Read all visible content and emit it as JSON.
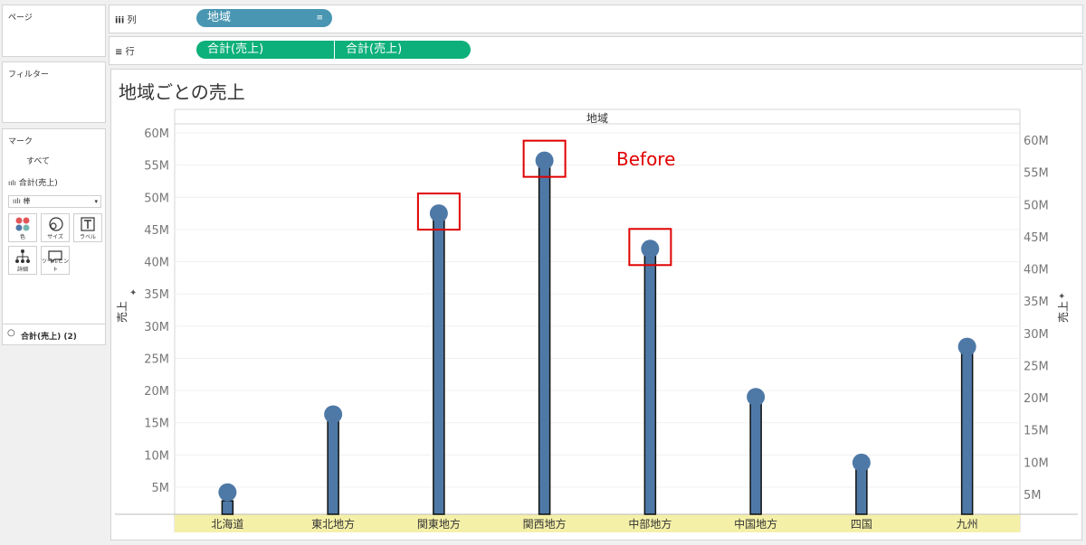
{
  "sidebar": {
    "pages_title": "ページ",
    "filters_title": "フィルター",
    "marks_title": "マーク",
    "marks_all": "すべて",
    "marks_measure": "合計(売上)",
    "mark_type": "棒",
    "mark_buttons": [
      "色",
      "サイズ",
      "ラベル",
      "詳細",
      "ツールヒント"
    ],
    "marks_measure2": "合計(売上) (2)"
  },
  "shelves": {
    "columns_label": "列",
    "rows_label": "行",
    "columns_pill": "地域",
    "rows_pill1": "合計(売上)",
    "rows_pill2": "合計(売上)"
  },
  "view": {
    "title": "地域ごとの売上",
    "header": "地域",
    "annotation": "Before"
  },
  "colors": {
    "bar": "#4e79a7",
    "circle": "#4e79a7",
    "highlight_box": "#e00000",
    "category_band": "#f5f0a8"
  },
  "chart_data": {
    "type": "bar",
    "categories": [
      "北海道",
      "東北地方",
      "関東地方",
      "関西地方",
      "中部地方",
      "中国地方",
      "四国",
      "九州"
    ],
    "values": [
      4.2,
      16.3,
      47.5,
      55.7,
      42.0,
      19.0,
      8.8,
      26.8
    ],
    "y_unit": "M",
    "left_axis": {
      "ylim": [
        0,
        63
      ],
      "ticks": [
        "5M",
        "10M",
        "15M",
        "20M",
        "25M",
        "30M",
        "35M",
        "40M",
        "45M",
        "50M",
        "55M",
        "60M"
      ],
      "label": "売上"
    },
    "right_axis": {
      "ylim": [
        0,
        64
      ],
      "ticks": [
        "5M",
        "10M",
        "15M",
        "20M",
        "25M",
        "30M",
        "35M",
        "40M",
        "45M",
        "50M",
        "55M",
        "60M"
      ],
      "label": "売上"
    },
    "bar_values_right": [
      4.0,
      17.0,
      48.5,
      57.0,
      43.0,
      19.5,
      9.0,
      27.5
    ],
    "highlighted": [
      "関東地方",
      "関西地方",
      "中部地方"
    ],
    "xlabel": "地域"
  }
}
